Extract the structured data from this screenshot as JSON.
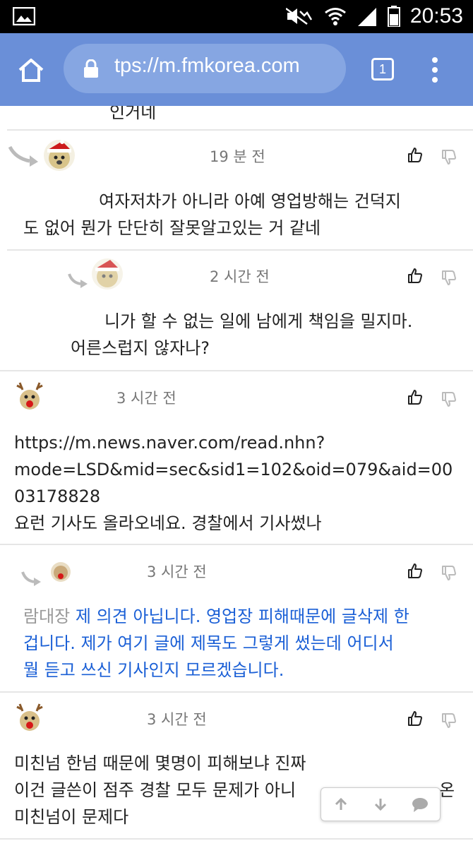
{
  "status_bar": {
    "time": "20:53",
    "icons": [
      "image-icon",
      "mute-icon",
      "wifi-icon",
      "signal-icon",
      "battery-icon"
    ]
  },
  "browser": {
    "url": "tps://m.fmkorea.com",
    "tab_count": "1"
  },
  "comments": [
    {
      "id": "c0",
      "partial_text": "인거네"
    },
    {
      "id": "c1",
      "time": "19 분 전",
      "text": [
        "여자저차가 아니라 아예 영업방해는 건덕지",
        "도 없어 뭔가 단단히 잘못알고있는 거 같네"
      ],
      "reply": true
    },
    {
      "id": "c2",
      "time": "2 시간 전",
      "text": [
        "니가 할 수 없는 일에 남에게 책임을 밀지마.",
        "어른스럽지 않자나?"
      ],
      "reply": true
    },
    {
      "id": "c3",
      "time": "3 시간 전",
      "text": [
        "https://m.news.naver.com/read.nhn?",
        "mode=LSD&mid=sec&sid1=102&oid=079&aid=00",
        "03178828",
        "요런 기사도 올라오네요. 경찰에서 기사썼나"
      ],
      "reply": false
    },
    {
      "id": "c4",
      "time": "3 시간 전",
      "mention": "람대장",
      "text": [
        "제 의견 아닙니다. 영업장 피해때문에 글삭제 한",
        "겁니다. 제가 여기 글에 제목도 그렇게 썼는데 어디서",
        "뭘 듣고 쓰신 기사인지 모르겠습니다."
      ],
      "reply": true
    },
    {
      "id": "c5",
      "time": "3 시간 전",
      "text": [
        "미친넘 한넘 때문에 몇명이 피해보냐 진짜",
        "이건 글쓴이 점주 경찰 모두 문제가 아니",
        "미친넘이 문제다"
      ],
      "trailing": "온",
      "reply": false
    }
  ],
  "colors": {
    "toolbar": "#6a8fd8",
    "urlbar": "#86a6e2",
    "link_blue": "#1a5fd6"
  }
}
